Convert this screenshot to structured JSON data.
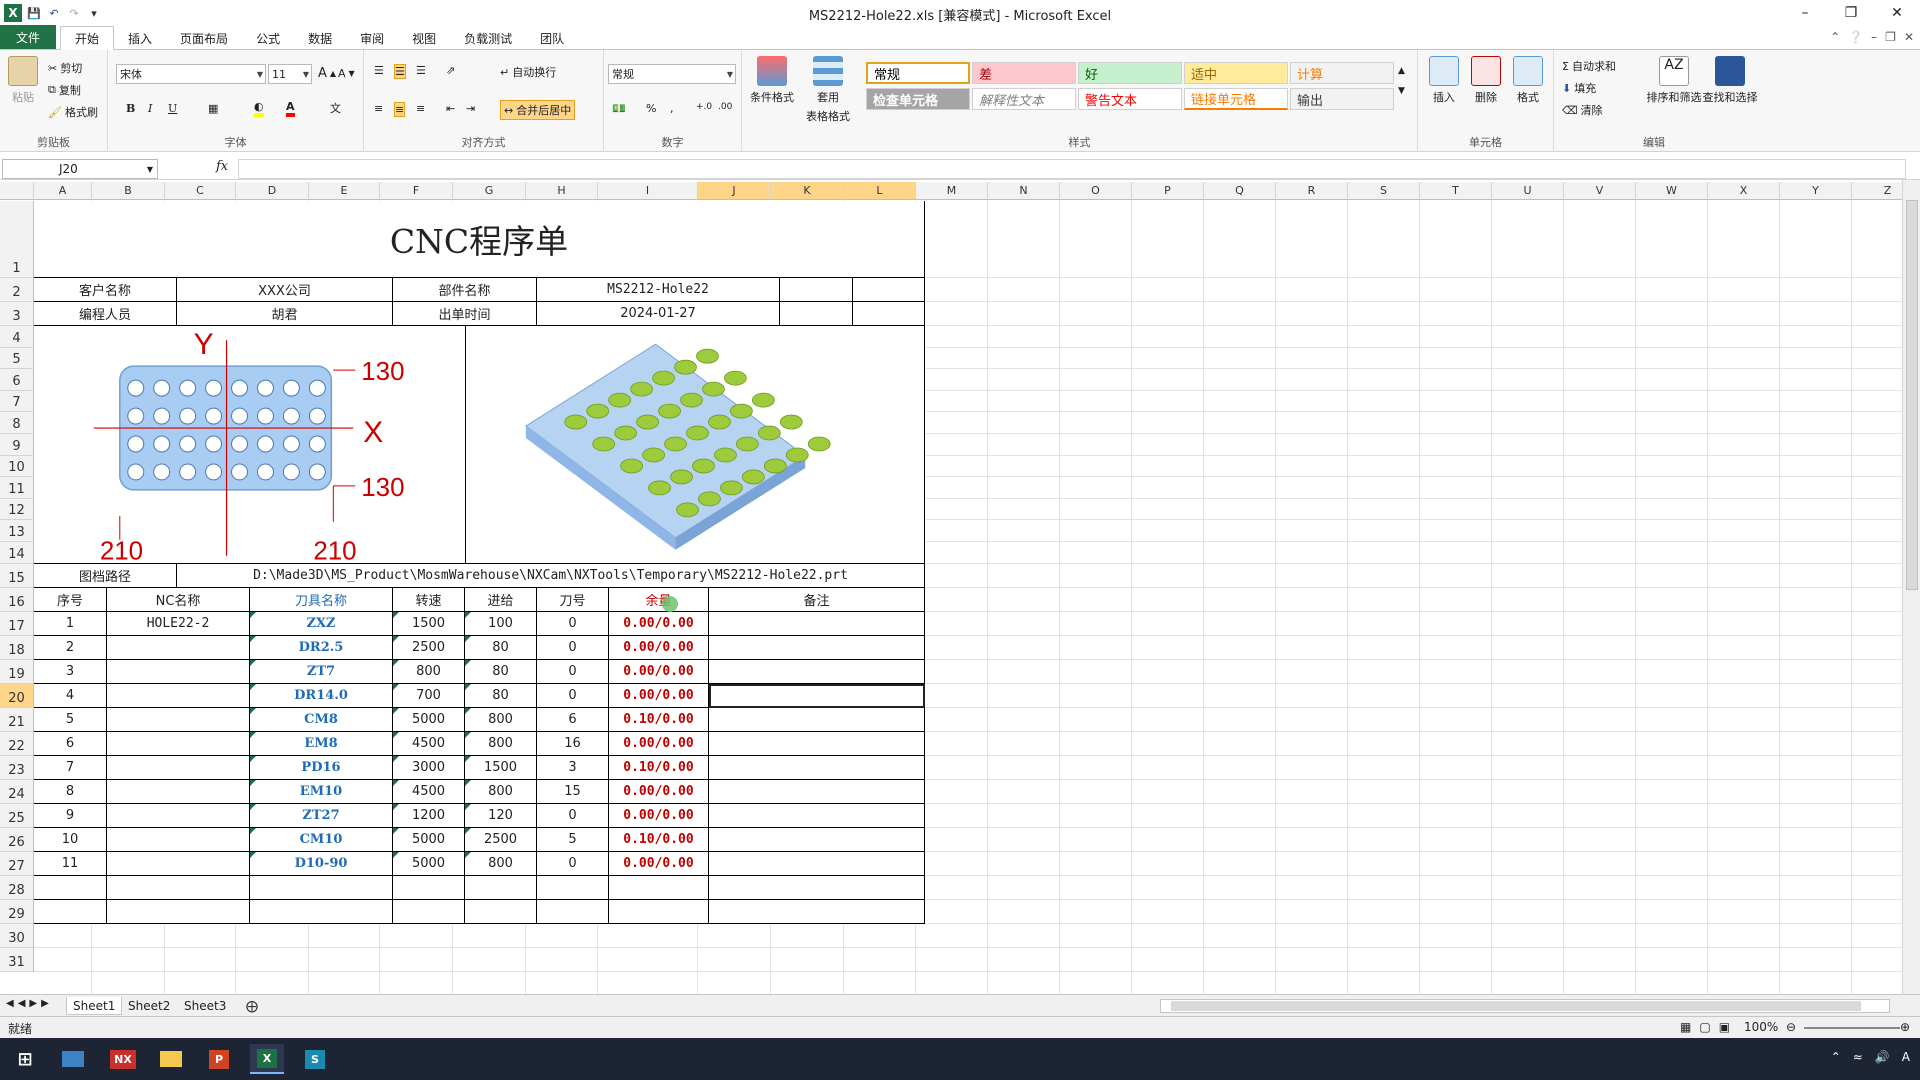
{
  "window": {
    "title": "MS2212-Hole22.xls  [兼容模式] - Microsoft Excel"
  },
  "tabs": [
    "文件",
    "开始",
    "插入",
    "页面布局",
    "公式",
    "数据",
    "审阅",
    "视图",
    "负载测试",
    "团队"
  ],
  "ribbon": {
    "clipboard": {
      "label": "剪贴板",
      "paste": "粘贴",
      "cut": "剪切",
      "copy": "复制",
      "format_painter": "格式刷"
    },
    "font": {
      "label": "字体",
      "name": "宋体",
      "size": "11",
      "bold": "B",
      "italic": "I",
      "underline": "U"
    },
    "alignment": {
      "label": "对齐方式",
      "wrap": "自动换行",
      "merge": "合并后居中"
    },
    "number": {
      "label": "数字",
      "format": "常规",
      "percent": "%",
      "comma": ","
    },
    "styles_group": {
      "label": "样式",
      "conditional": "条件格式",
      "table_format_1": "套用",
      "table_format_2": "表格格式",
      "items": [
        {
          "text": "常规",
          "bg": "#ffffff",
          "color": "#000000"
        },
        {
          "text": "差",
          "bg": "#ffc7ce",
          "color": "#9c0006"
        },
        {
          "text": "好",
          "bg": "#c6efce",
          "color": "#006100"
        },
        {
          "text": "适中",
          "bg": "#ffeb9c",
          "color": "#9c6500"
        },
        {
          "text": "计算",
          "bg": "#f2f2f2",
          "color": "#fa7d00"
        },
        {
          "text": "检查单元格",
          "bg": "#a5a5a5",
          "color": "#ffffff"
        },
        {
          "text": "解释性文本",
          "bg": "#ffffff",
          "color": "#7f7f7f"
        },
        {
          "text": "警告文本",
          "bg": "#ffffff",
          "color": "#ff0000"
        },
        {
          "text": "链接单元格",
          "bg": "#ffffff",
          "color": "#fa7d00"
        },
        {
          "text": "输出",
          "bg": "#f2f2f2",
          "color": "#3f3f3f"
        }
      ]
    },
    "cells": {
      "label": "单元格",
      "insert": "插入",
      "delete": "删除",
      "format": "格式"
    },
    "editing": {
      "label": "编辑",
      "autosum": "自动求和",
      "fill": "填充",
      "clear": "清除",
      "sort": "排序和筛选",
      "find": "查找和选择"
    }
  },
  "formula_bar": {
    "name_box": "J20",
    "fx": "fx",
    "value": ""
  },
  "columns": [
    "A",
    "B",
    "C",
    "D",
    "E",
    "F",
    "G",
    "H",
    "I",
    "J",
    "K",
    "L",
    "M",
    "N",
    "O",
    "P",
    "Q",
    "R",
    "S",
    "T",
    "U",
    "V",
    "W",
    "X",
    "Y",
    "Z"
  ],
  "rows": [
    "1",
    "2",
    "3",
    "4",
    "5",
    "6",
    "7",
    "8",
    "9",
    "10",
    "11",
    "12",
    "13",
    "14",
    "15",
    "16",
    "17",
    "18",
    "19",
    "20",
    "21",
    "22",
    "23",
    "24",
    "25",
    "26",
    "27",
    "28",
    "29",
    "30",
    "31"
  ],
  "sheet": {
    "title": "CNC程序单",
    "customer_label": "客户名称",
    "customer": "XXX公司",
    "part_label": "部件名称",
    "part": "MS2212-Hole22",
    "programmer_label": "编程人员",
    "programmer": "胡君",
    "date_label": "出单时间",
    "date": "2024-01-27",
    "path_label": "图档路径",
    "path": "D:\\Made3D\\MS_Product\\MosmWarehouse\\NXCam\\NXTools\\Temporary\\MS2212-Hole22.prt",
    "drawing": {
      "y_label": "Y",
      "x_label": "X",
      "dim_130": "130",
      "dim_210": "210"
    },
    "headers": [
      "序号",
      "NC名称",
      "刀具名称",
      "转速",
      "进给",
      "刀号",
      "余量",
      "备注"
    ],
    "rows": [
      {
        "no": "1",
        "nc": "HOLE22-2",
        "tool": "ZXZ",
        "speed": "1500",
        "feed": "100",
        "tnum": "0",
        "allow": "0.00/0.00"
      },
      {
        "no": "2",
        "nc": "",
        "tool": "DR2.5",
        "speed": "2500",
        "feed": "80",
        "tnum": "0",
        "allow": "0.00/0.00"
      },
      {
        "no": "3",
        "nc": "",
        "tool": "ZT7",
        "speed": "800",
        "feed": "80",
        "tnum": "0",
        "allow": "0.00/0.00"
      },
      {
        "no": "4",
        "nc": "",
        "tool": "DR14.0",
        "speed": "700",
        "feed": "80",
        "tnum": "0",
        "allow": "0.00/0.00"
      },
      {
        "no": "5",
        "nc": "",
        "tool": "CM8",
        "speed": "5000",
        "feed": "800",
        "tnum": "6",
        "allow": "0.10/0.00"
      },
      {
        "no": "6",
        "nc": "",
        "tool": "EM8",
        "speed": "4500",
        "feed": "800",
        "tnum": "16",
        "allow": "0.00/0.00"
      },
      {
        "no": "7",
        "nc": "",
        "tool": "PD16",
        "speed": "3000",
        "feed": "1500",
        "tnum": "3",
        "allow": "0.10/0.00"
      },
      {
        "no": "8",
        "nc": "",
        "tool": "EM10",
        "speed": "4500",
        "feed": "800",
        "tnum": "15",
        "allow": "0.00/0.00"
      },
      {
        "no": "9",
        "nc": "",
        "tool": "ZT27",
        "speed": "1200",
        "feed": "120",
        "tnum": "0",
        "allow": "0.00/0.00"
      },
      {
        "no": "10",
        "nc": "",
        "tool": "CM10",
        "speed": "5000",
        "feed": "2500",
        "tnum": "5",
        "allow": "0.10/0.00"
      },
      {
        "no": "11",
        "nc": "",
        "tool": "D10-90",
        "speed": "5000",
        "feed": "800",
        "tnum": "0",
        "allow": "0.00/0.00"
      }
    ]
  },
  "sheet_tabs": [
    "Sheet1",
    "Sheet2",
    "Sheet3"
  ],
  "status": {
    "ready": "就绪",
    "zoom": "100%"
  },
  "taskbar": {
    "nx": "NX",
    "ppt": "P",
    "excel": "X",
    "ps": "S"
  }
}
